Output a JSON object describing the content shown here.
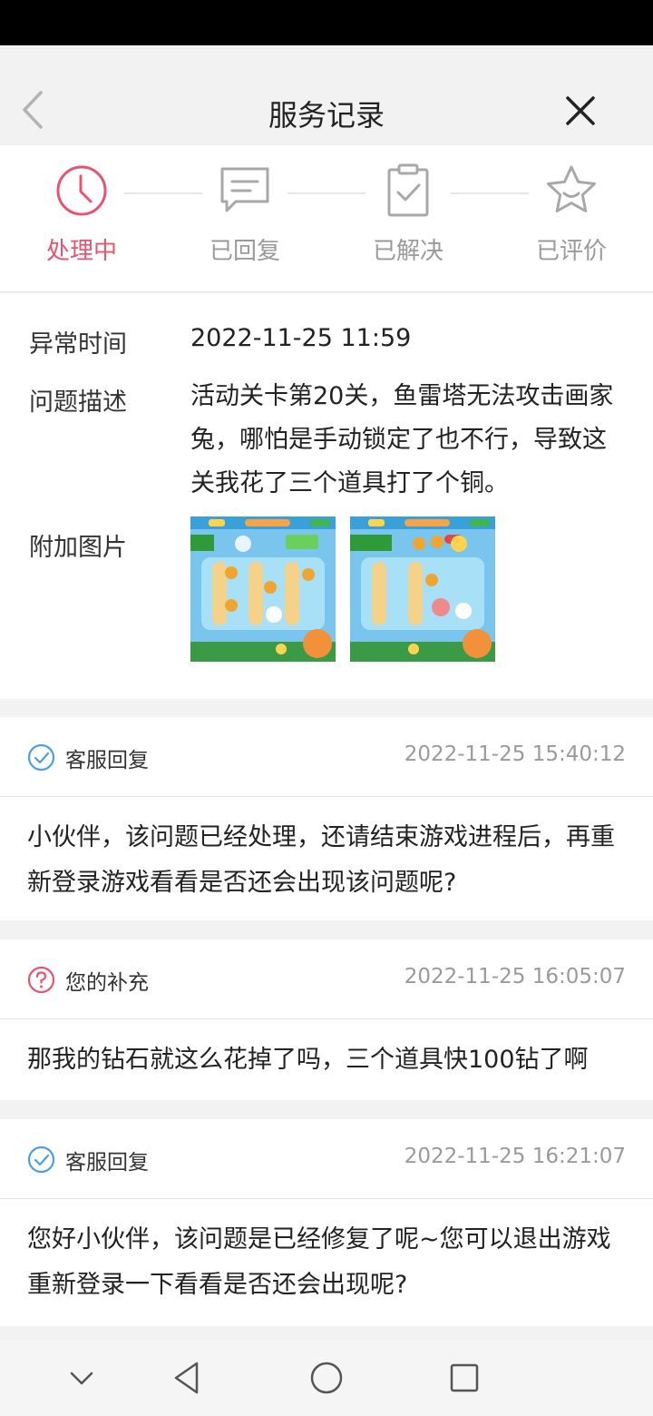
{
  "header": {
    "title": "服务记录"
  },
  "steps": [
    {
      "label": "处理中",
      "icon": "clock-icon",
      "active": true
    },
    {
      "label": "已回复",
      "icon": "chat-icon",
      "active": false
    },
    {
      "label": "已解决",
      "icon": "clipboard-check-icon",
      "active": false
    },
    {
      "label": "已评价",
      "icon": "star-icon",
      "active": false
    }
  ],
  "detail": {
    "time_label": "异常时间",
    "time_value": "2022-11-25 11:59",
    "desc_label": "问题描述",
    "desc_value": "活动关卡第20关，鱼雷塔无法攻击画家兔，哪怕是手动锁定了也不行，导致这关我花了三个道具打了个铜。",
    "images_label": "附加图片"
  },
  "records": [
    {
      "type": "客服回复",
      "icon": "check-circle-icon",
      "time": "2022-11-25 15:40:12",
      "content": "小伙伴，该问题已经处理，还请结束游戏进程后，再重新登录游戏看看是否还会出现该问题呢?"
    },
    {
      "type": "您的补充",
      "icon": "question-circle-icon",
      "time": "2022-11-25 16:05:07",
      "content": "那我的钻石就这么花掉了吗，三个道具快100钻了啊"
    },
    {
      "type": "客服回复",
      "icon": "check-circle-icon",
      "time": "2022-11-25 16:21:07",
      "content": "您好小伙伴，该问题是已经修复了呢~您可以退出游戏重新登录一下看看是否还会出现呢?"
    }
  ],
  "colors": {
    "accent": "#e8546f",
    "blue": "#4a9fe8",
    "muted": "#9a9a9a"
  }
}
